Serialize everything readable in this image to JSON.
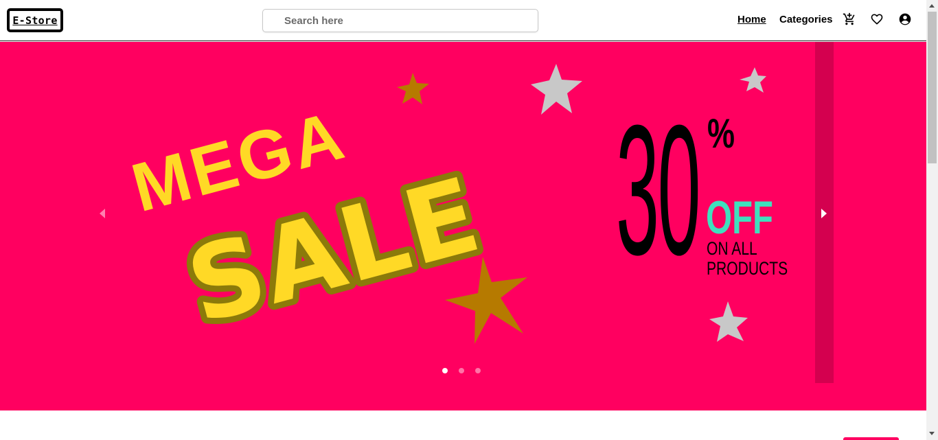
{
  "navbar": {
    "logo_text": "E-Store",
    "search_placeholder": "Search here",
    "links": {
      "home": "Home",
      "categories": "Categories"
    },
    "icons": [
      "cart-icon",
      "heart-icon",
      "account-icon"
    ]
  },
  "banner": {
    "headline_top": "MEGA",
    "headline_main": "SALE",
    "discount_number": "30",
    "discount_symbol": "%",
    "off_text": "OFF",
    "subtext_line1": "ON ALL",
    "subtext_line2": "PRODUCTS",
    "colors": {
      "background": "#ff0060",
      "headline": "#ffd926",
      "outline": "#8b7a0a",
      "off": "#3fe0bd",
      "stars_gold": "#b67a00",
      "stars_silver": "#c8c8c8"
    }
  },
  "carousel": {
    "slide_count": 3,
    "active_slide": 1,
    "prev_icon": "chevron-left-icon",
    "next_icon": "chevron-right-icon"
  }
}
